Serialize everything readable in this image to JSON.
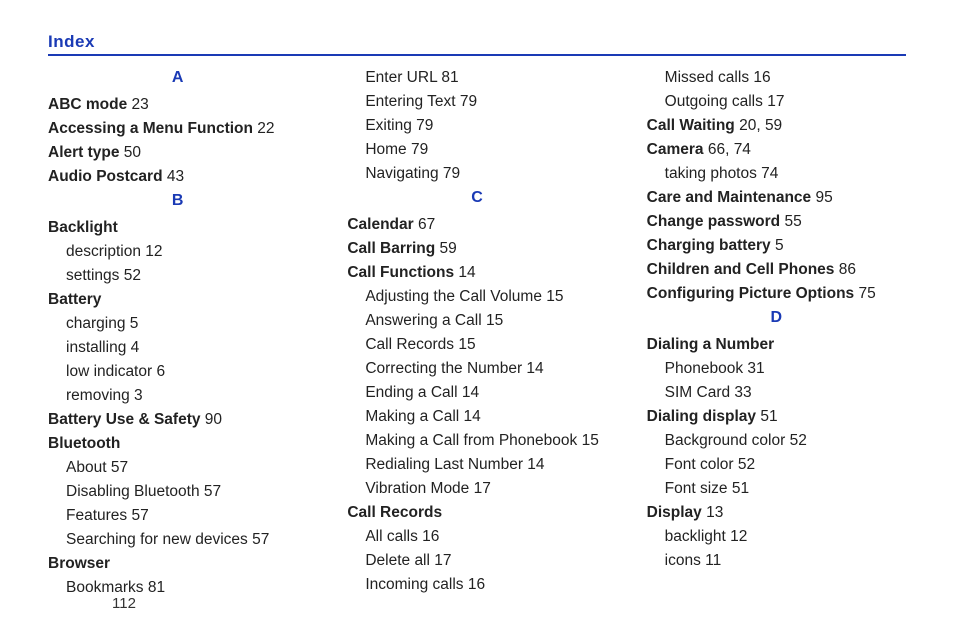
{
  "title": "Index",
  "pageNumber": "112",
  "columns": [
    [
      {
        "type": "letter",
        "text": "A"
      },
      {
        "type": "main",
        "term": "ABC mode",
        "page": "23"
      },
      {
        "type": "main",
        "term": "Accessing a Menu Function",
        "page": "22"
      },
      {
        "type": "main",
        "term": "Alert type",
        "page": "50"
      },
      {
        "type": "main",
        "term": "Audio Postcard",
        "page": "43"
      },
      {
        "type": "letter",
        "text": "B"
      },
      {
        "type": "main",
        "term": "Backlight",
        "page": ""
      },
      {
        "type": "sub",
        "term": "description",
        "page": "12"
      },
      {
        "type": "sub",
        "term": "settings",
        "page": "52"
      },
      {
        "type": "main",
        "term": "Battery",
        "page": ""
      },
      {
        "type": "sub",
        "term": "charging",
        "page": "5"
      },
      {
        "type": "sub",
        "term": "installing",
        "page": "4"
      },
      {
        "type": "sub",
        "term": "low indicator",
        "page": "6"
      },
      {
        "type": "sub",
        "term": "removing",
        "page": "3"
      },
      {
        "type": "main",
        "term": "Battery Use & Safety",
        "page": "90"
      },
      {
        "type": "main",
        "term": "Bluetooth",
        "page": ""
      },
      {
        "type": "sub",
        "term": "About",
        "page": "57"
      },
      {
        "type": "sub",
        "term": "Disabling Bluetooth",
        "page": "57"
      },
      {
        "type": "sub",
        "term": "Features",
        "page": "57"
      },
      {
        "type": "sub",
        "term": "Searching for new devices",
        "page": "57"
      },
      {
        "type": "main",
        "term": "Browser",
        "page": ""
      },
      {
        "type": "sub",
        "term": "Bookmarks",
        "page": "81"
      }
    ],
    [
      {
        "type": "sub",
        "term": "Enter URL",
        "page": "81"
      },
      {
        "type": "sub",
        "term": "Entering Text",
        "page": "79"
      },
      {
        "type": "sub",
        "term": "Exiting",
        "page": "79"
      },
      {
        "type": "sub",
        "term": "Home",
        "page": "79"
      },
      {
        "type": "sub",
        "term": "Navigating",
        "page": "79"
      },
      {
        "type": "letter",
        "text": "C"
      },
      {
        "type": "main",
        "term": "Calendar",
        "page": "67"
      },
      {
        "type": "main",
        "term": "Call Barring",
        "page": "59"
      },
      {
        "type": "main",
        "term": "Call Functions",
        "page": "14"
      },
      {
        "type": "sub",
        "term": "Adjusting the Call Volume",
        "page": "15"
      },
      {
        "type": "sub",
        "term": "Answering a Call",
        "page": "15"
      },
      {
        "type": "sub",
        "term": "Call Records",
        "page": "15"
      },
      {
        "type": "sub",
        "term": "Correcting the Number",
        "page": "14"
      },
      {
        "type": "sub",
        "term": "Ending a Call",
        "page": "14"
      },
      {
        "type": "sub",
        "term": "Making a Call",
        "page": "14"
      },
      {
        "type": "sub",
        "term": "Making a Call from Phonebook",
        "page": "15"
      },
      {
        "type": "sub",
        "term": "Redialing Last Number",
        "page": "14"
      },
      {
        "type": "sub",
        "term": "Vibration Mode",
        "page": "17"
      },
      {
        "type": "main",
        "term": "Call Records",
        "page": ""
      },
      {
        "type": "sub",
        "term": "All calls",
        "page": "16"
      },
      {
        "type": "sub",
        "term": "Delete all",
        "page": "17"
      },
      {
        "type": "sub",
        "term": "Incoming calls",
        "page": "16"
      }
    ],
    [
      {
        "type": "sub",
        "term": "Missed calls",
        "page": "16"
      },
      {
        "type": "sub",
        "term": "Outgoing calls",
        "page": "17"
      },
      {
        "type": "main",
        "term": "Call Waiting",
        "page": "20, 59"
      },
      {
        "type": "main",
        "term": "Camera",
        "page": "66, 74"
      },
      {
        "type": "sub",
        "term": "taking photos",
        "page": "74"
      },
      {
        "type": "main",
        "term": "Care and Maintenance",
        "page": "95"
      },
      {
        "type": "main",
        "term": "Change password",
        "page": "55"
      },
      {
        "type": "main",
        "term": "Charging battery",
        "page": "5"
      },
      {
        "type": "main",
        "term": "Children and Cell Phones",
        "page": "86"
      },
      {
        "type": "main",
        "term": "Configuring Picture Options",
        "page": "75"
      },
      {
        "type": "letter",
        "text": "D"
      },
      {
        "type": "main",
        "term": "Dialing a Number",
        "page": ""
      },
      {
        "type": "sub",
        "term": "Phonebook",
        "page": "31"
      },
      {
        "type": "sub",
        "term": "SIM Card",
        "page": "33"
      },
      {
        "type": "main",
        "term": "Dialing display",
        "page": "51"
      },
      {
        "type": "sub",
        "term": "Background color",
        "page": "52"
      },
      {
        "type": "sub",
        "term": "Font color",
        "page": "52"
      },
      {
        "type": "sub",
        "term": "Font size",
        "page": "51"
      },
      {
        "type": "main",
        "term": "Display",
        "page": "13"
      },
      {
        "type": "sub",
        "term": "backlight",
        "page": "12"
      },
      {
        "type": "sub",
        "term": "icons",
        "page": "11"
      }
    ]
  ]
}
